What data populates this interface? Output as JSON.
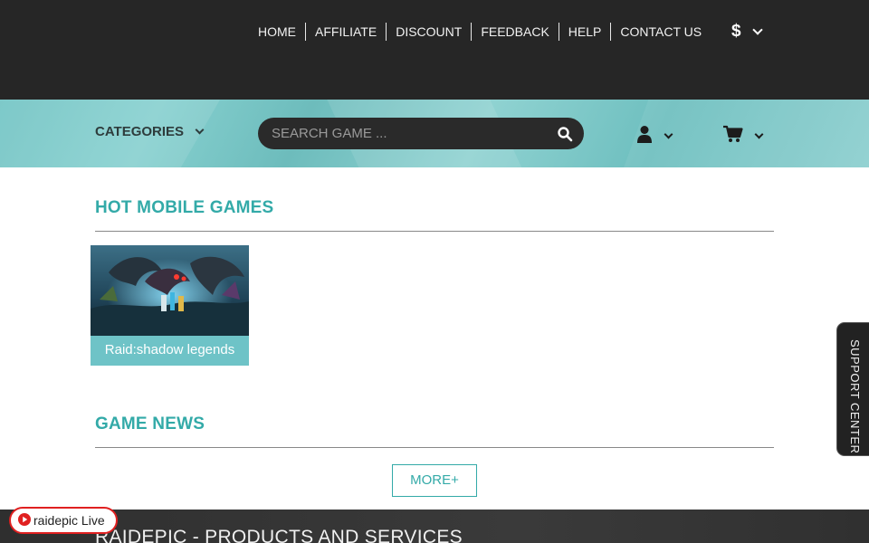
{
  "topnav": {
    "links": [
      "HOME",
      "AFFILIATE",
      "DISCOUNT",
      "FEEDBACK",
      "HELP",
      "CONTACT US"
    ],
    "currency_symbol": "$"
  },
  "searchbar": {
    "categories_label": "CATEGORIES",
    "search_placeholder": "SEARCH GAME ...",
    "search_icon": "search-icon",
    "user_icon": "user-icon",
    "cart_icon": "cart-icon"
  },
  "hot_games": {
    "title": "HOT MOBILE GAMES",
    "games": [
      {
        "name": "Raid:shadow legends"
      }
    ]
  },
  "news": {
    "title": "GAME NEWS",
    "more_label": "MORE+"
  },
  "footer": {
    "title": "RAIDEPIC - PRODUCTS AND SERVICES"
  },
  "live_badge": {
    "label": "raidepic Live",
    "icon": "play-circle-icon"
  },
  "support": {
    "label": "SUPPORT CENTER"
  },
  "colors": {
    "accent": "#33aaa8",
    "topbar": "#262626",
    "band": "#7ac8c8",
    "live_red": "#e02020"
  }
}
